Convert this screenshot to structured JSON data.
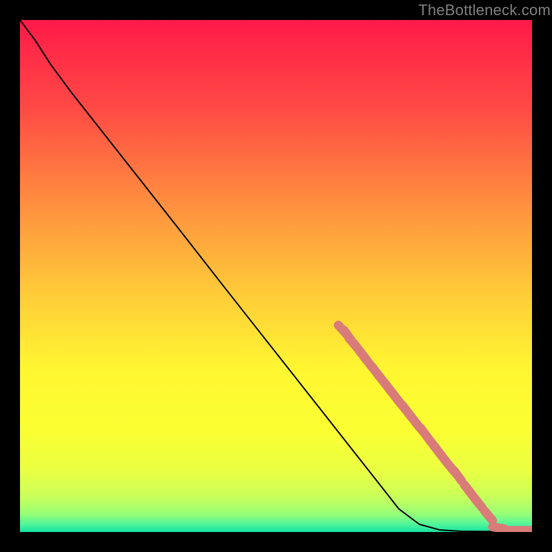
{
  "watermark": "TheBottleneck.com",
  "chart_data": {
    "type": "line",
    "title": "",
    "xlabel": "",
    "ylabel": "",
    "xlim": [
      0,
      100
    ],
    "ylim": [
      0,
      100
    ],
    "grid": false,
    "series": [
      {
        "name": "curve",
        "style": "line-black",
        "points": [
          {
            "x": 0.0,
            "y": 100.0
          },
          {
            "x": 3.0,
            "y": 96.0
          },
          {
            "x": 6.0,
            "y": 91.3
          },
          {
            "x": 10.0,
            "y": 85.9
          },
          {
            "x": 20.0,
            "y": 73.2
          },
          {
            "x": 30.0,
            "y": 60.5
          },
          {
            "x": 40.0,
            "y": 47.7
          },
          {
            "x": 50.0,
            "y": 35.0
          },
          {
            "x": 60.0,
            "y": 22.3
          },
          {
            "x": 70.0,
            "y": 9.6
          },
          {
            "x": 74.0,
            "y": 4.5
          },
          {
            "x": 78.0,
            "y": 1.5
          },
          {
            "x": 82.0,
            "y": 0.4
          },
          {
            "x": 86.0,
            "y": 0.15
          },
          {
            "x": 90.0,
            "y": 0.1
          },
          {
            "x": 95.0,
            "y": 0.1
          },
          {
            "x": 100.0,
            "y": 0.1
          }
        ]
      },
      {
        "name": "highlighted-points",
        "style": "thick-salmon-segments",
        "points": [
          {
            "x": 63.0,
            "y": 39.5
          },
          {
            "x": 64.0,
            "y": 38.4
          },
          {
            "x": 65.0,
            "y": 37.0
          },
          {
            "x": 66.0,
            "y": 35.8
          },
          {
            "x": 67.0,
            "y": 34.5
          },
          {
            "x": 68.0,
            "y": 33.2
          },
          {
            "x": 69.5,
            "y": 31.3
          },
          {
            "x": 70.5,
            "y": 30.0
          },
          {
            "x": 72.0,
            "y": 28.1
          },
          {
            "x": 73.0,
            "y": 26.8
          },
          {
            "x": 74.5,
            "y": 24.9
          },
          {
            "x": 75.5,
            "y": 23.7
          },
          {
            "x": 76.5,
            "y": 22.4
          },
          {
            "x": 78.0,
            "y": 20.5
          },
          {
            "x": 79.0,
            "y": 19.3
          },
          {
            "x": 80.5,
            "y": 17.3
          },
          {
            "x": 81.5,
            "y": 16.0
          },
          {
            "x": 82.5,
            "y": 14.7
          },
          {
            "x": 84.0,
            "y": 12.8
          },
          {
            "x": 85.5,
            "y": 11.0
          },
          {
            "x": 87.5,
            "y": 8.3
          },
          {
            "x": 88.5,
            "y": 7.0
          },
          {
            "x": 89.5,
            "y": 5.7
          },
          {
            "x": 91.5,
            "y": 3.2
          },
          {
            "x": 93.5,
            "y": 0.8
          },
          {
            "x": 96.5,
            "y": 0.3
          },
          {
            "x": 99.5,
            "y": 0.3
          }
        ]
      }
    ],
    "background_gradient_stops": [
      {
        "pos": 0.0,
        "color": "#ff1a49"
      },
      {
        "pos": 0.17,
        "color": "#ff4945"
      },
      {
        "pos": 0.35,
        "color": "#ff8c40"
      },
      {
        "pos": 0.53,
        "color": "#ffca39"
      },
      {
        "pos": 0.68,
        "color": "#fff631"
      },
      {
        "pos": 0.8,
        "color": "#fbff32"
      },
      {
        "pos": 0.88,
        "color": "#eaff42"
      },
      {
        "pos": 0.93,
        "color": "#caff59"
      },
      {
        "pos": 0.965,
        "color": "#97ff78"
      },
      {
        "pos": 0.985,
        "color": "#50f59b"
      },
      {
        "pos": 1.0,
        "color": "#14e3a2"
      }
    ],
    "marker_color": "#d97b78"
  }
}
